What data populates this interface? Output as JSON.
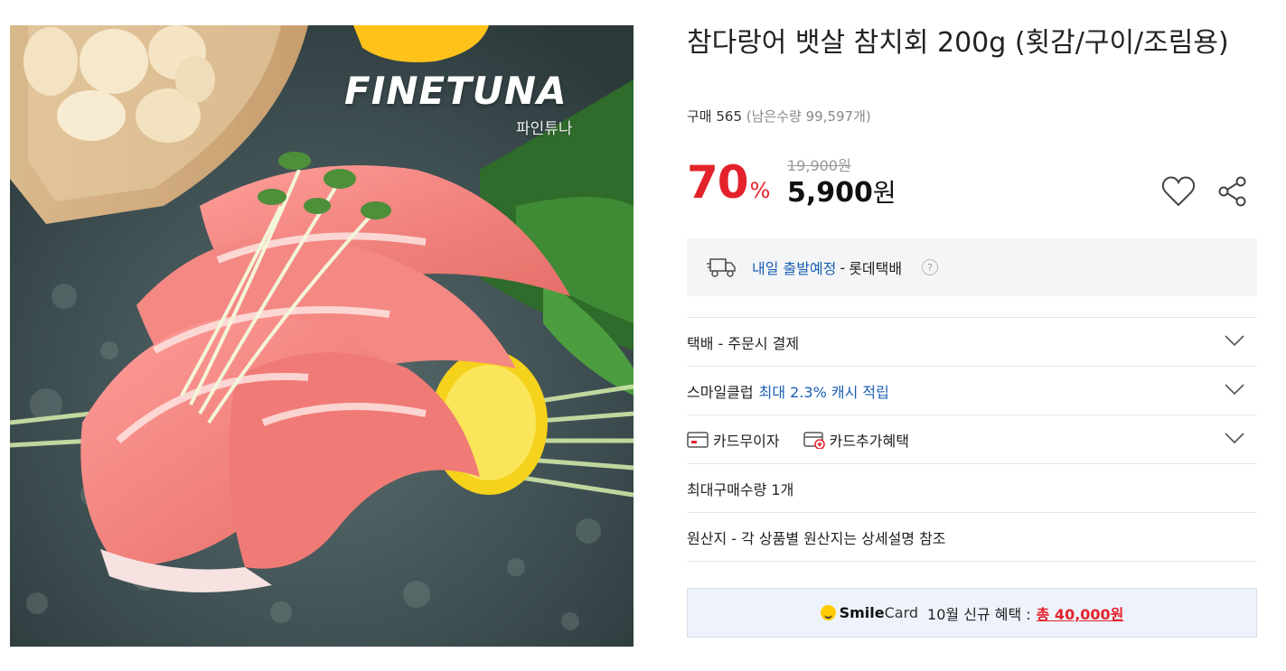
{
  "product_image": {
    "brand_name": "FINETUNA",
    "brand_sub": "파인튜나"
  },
  "product": {
    "title": "참다랑어 뱃살 참치회 200g (횟감/구이/조림용)",
    "purchase_label": "구매 565",
    "stock_label": "(남은수량 99,597개)",
    "discount_number": "70",
    "discount_unit": "%",
    "original_price": "19,900원",
    "sale_amount": "5,900",
    "sale_unit": "원"
  },
  "shipping": {
    "schedule": "내일 출발예정",
    "separator": "-",
    "carrier": "롯데택배",
    "help": "?"
  },
  "rows": {
    "delivery": "택배 - 주문시 결제",
    "smileclub_label": "스마일클럽",
    "smileclub_benefit": "최대 2.3% 캐시 적립",
    "card_interest_free": "카드무이자",
    "card_extra_benefit": "카드추가혜택",
    "max_purchase": "최대구매수량 1개",
    "origin": "원산지 - 각 상품별 원산지는 상세설명 참조"
  },
  "smilecard": {
    "brand_bold": "Smile",
    "brand_rest": "Card",
    "promo_text": "10월 신규 혜택 :",
    "promo_total": "총 40,000원"
  },
  "colors": {
    "accent_red": "#e4222c",
    "link_blue": "#1a5fb4",
    "panel_gray": "#f4f5f7",
    "smilecard_bg": "#eef3fb"
  },
  "icons": {
    "wish": "heart-icon",
    "share": "share-icon",
    "truck": "truck-icon",
    "help": "help-icon",
    "chevron": "chevron-down-icon",
    "card": "card-icon",
    "card_plus": "card-plus-icon"
  }
}
